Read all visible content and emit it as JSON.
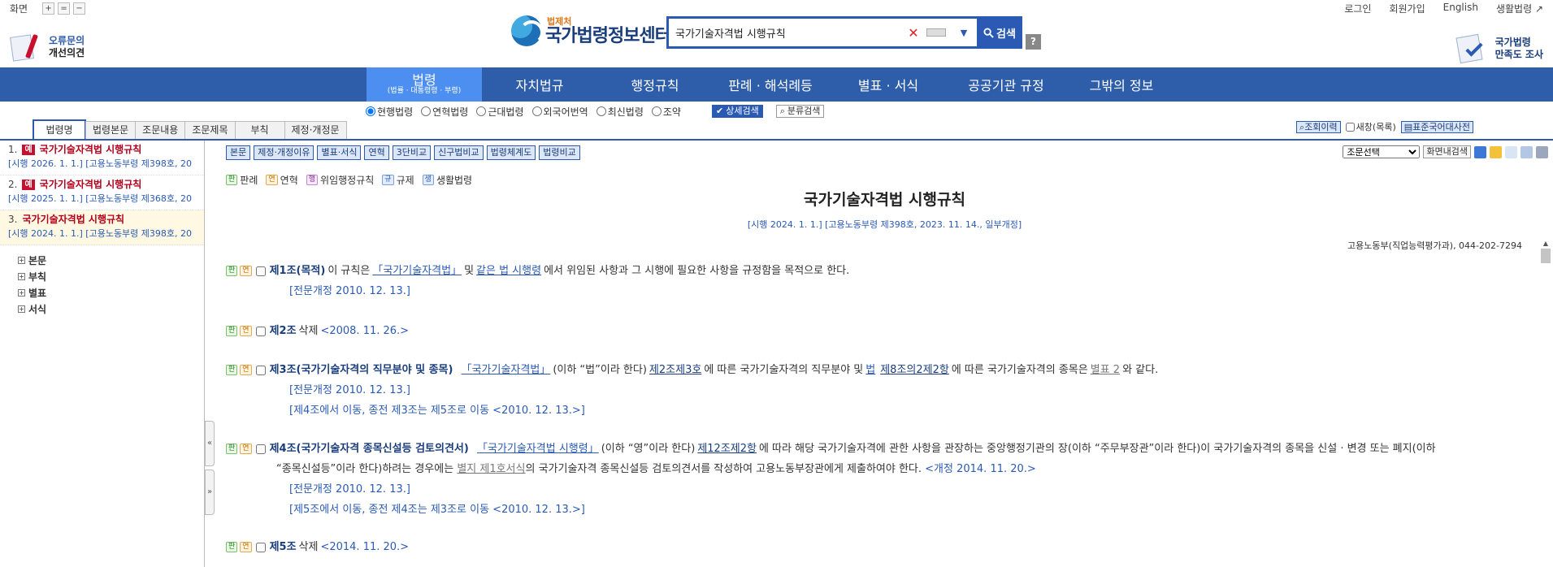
{
  "header": {
    "screen_label": "화면",
    "zoom_in": "+",
    "zoom_reset": "=",
    "zoom_out": "−",
    "improve_line1": "오류문의",
    "improve_line2": "개선의견",
    "logo_sub": "법제처",
    "logo_main": "국가법령정보센터",
    "search_value": "국가기술자격법 시행규칙",
    "search_clear": "✕",
    "search_dropdown": "▼",
    "search_button": "검색",
    "help": "?",
    "links": [
      "로그인",
      "회원가입",
      "English",
      "생활법령 ↗"
    ],
    "survey_line1": "국가법령",
    "survey_line2": "만족도 조사"
  },
  "nav": {
    "active_label": "법령",
    "active_sub": "(법률 · 대통령령 · 부령)",
    "items": [
      "자치법규",
      "행정규칙",
      "판례 · 해석례등",
      "별표 · 서식",
      "공공기관 규정",
      "그밖의 정보"
    ]
  },
  "filters": {
    "options": [
      "현행법령",
      "연혁법령",
      "근대법령",
      "외국어번역",
      "최신법령",
      "조약"
    ],
    "selected": "현행법령",
    "detail_search": "상세검색",
    "category_search": "분류검색"
  },
  "left_tabs": [
    "법령명",
    "법령본문",
    "조문내용",
    "조문제목",
    "부칙",
    "제정·개정문"
  ],
  "right_tools": {
    "history": "조회이력",
    "new_window": "새창(목록)",
    "dictionary": "표준국어대사전"
  },
  "results": [
    {
      "num": "1.",
      "tag": "예",
      "title": "국가기술자격법 시행규칙",
      "detail": "[시행 2026. 1. 1.] [고용노동부령 제398호, 20"
    },
    {
      "num": "2.",
      "tag": "예",
      "title": "국가기술자격법 시행규칙",
      "detail": "[시행 2025. 1. 1.] [고용노동부령 제368호, 20"
    },
    {
      "num": "3.",
      "tag": "",
      "title": "국가기술자격법 시행규칙",
      "detail": "[시행 2024. 1. 1.] [고용노동부령 제398호, 20"
    }
  ],
  "tree": [
    "본문",
    "부칙",
    "별표",
    "서식"
  ],
  "content_toolbar": [
    "본문",
    "제정·개정이유",
    "별표·서식",
    "연혁",
    "3단비교",
    "신구법비교",
    "법령체계도",
    "법령비교"
  ],
  "content_right": {
    "select_label": "조문선택",
    "screen_save": "화면내검색"
  },
  "legend": {
    "items": [
      {
        "badge": "판",
        "label": "판례"
      },
      {
        "badge": "연",
        "label": "연혁"
      },
      {
        "badge": "행",
        "label": "위임행정규칙"
      },
      {
        "badge": "규",
        "label": "규제"
      },
      {
        "badge": "생",
        "label": "생활법령"
      }
    ]
  },
  "law": {
    "title": "국가기술자격법 시행규칙",
    "meta": "[시행 2024. 1. 1.] [고용노동부령 제398호, 2023. 11. 14., 일부개정]",
    "dept": "고용노동부(직업능력평가과), 044-202-7294"
  },
  "articles": {
    "a1": {
      "head": "제1조(목적)",
      "t1": " 이 규칙은 ",
      "l1": "「국가기술자격법」",
      "t2": " 및 ",
      "l2": "같은 법 시행령",
      "t3": "에서 위임된 사항과 그 시행에 필요한 사항을 규정함을 목적으로 한다.",
      "sub1": "[전문개정 2010. 12. 13.]"
    },
    "a2": {
      "head": "제2조",
      "t1": " 삭제 ",
      "amd": "<2008. 11. 26.>"
    },
    "a3": {
      "head": "제3조(국가기술자격의 직무분야 및 종목)",
      "l1": "「국가기술자격법」",
      "t1": "(이하 “법”이라 한다) ",
      "l2": "제2조제3호",
      "t2": "에 따른 국가기술자격의 직무분야 및 ",
      "l3": "법",
      "t3": " ",
      "l4": "제8조의2제2항",
      "t4": "에 따른 국가기술자격의 종목은 ",
      "l5": "별표 2",
      "t5": "와 같다.",
      "sub1": "[전문개정 2010. 12. 13.]",
      "sub2": "[제4조에서 이동, 종전 제3조는 제5조로 이동 <2010. 12. 13.>]"
    },
    "a4": {
      "head": "제4조(국가기술자격 종목신설등 검토의견서)",
      "l1": "「국가기술자격법 시행령」",
      "t1": "(이하 “영”이라 한다) ",
      "l2": "제12조제2항",
      "t2": "에 따라 해당 국가기술자격에 관한 사항을 관장하는 중앙행정기관의 장(이하 “주무부장관”이라 한다)이 국가기술자격의 종목을 신설 · 변경 또는 폐지(이하",
      "c1": "“종목신설등”이라 한다)하려는 경우에는 ",
      "l3": "별지 제1호서식",
      "c2": "의 국가기술자격 종목신설등 검토의견서를 작성하여 고용노동부장관에게 제출하여야 한다. ",
      "amd": "<개정 2014. 11. 20.>",
      "sub1": "[전문개정 2010. 12. 13.]",
      "sub2": "[제5조에서 이동, 종전 제4조는 제3조로 이동 <2010. 12. 13.>]"
    },
    "a5": {
      "head": "제5조",
      "t1": " 삭제 ",
      "amd": "<2014. 11. 20.>"
    }
  },
  "colors": {
    "nav_bg": "#2e5ea9",
    "nav_active": "#4c8ff0",
    "accent": "#2a5ab4",
    "result_title": "#b3001b"
  }
}
